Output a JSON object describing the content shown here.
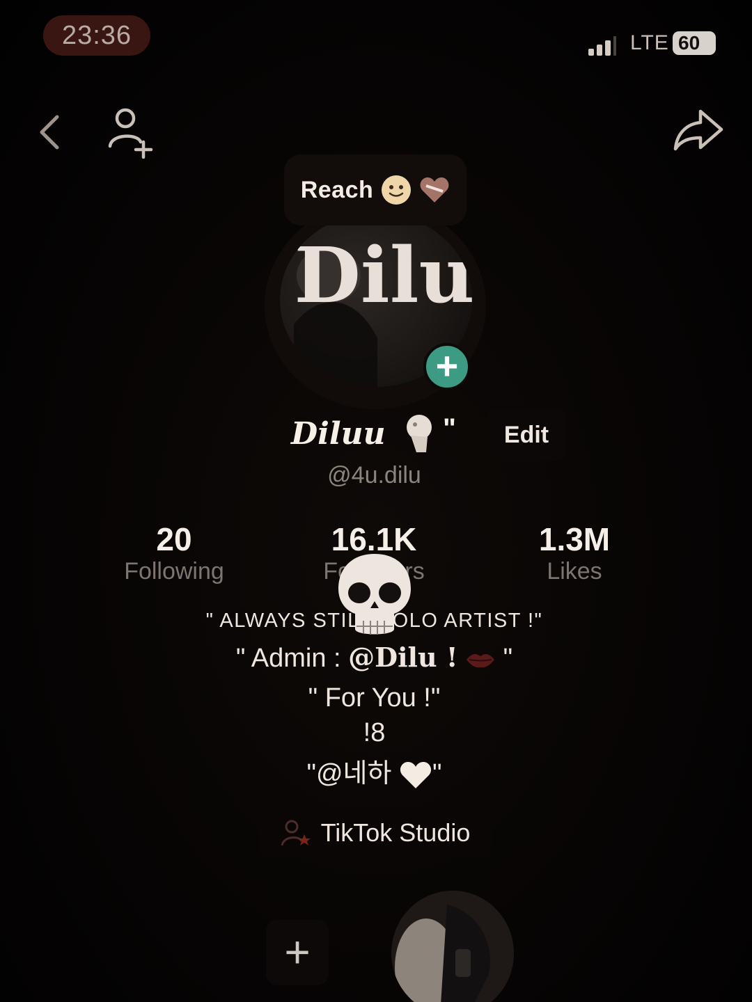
{
  "status_bar": {
    "time": "23:36",
    "network": "LTE",
    "battery": "60"
  },
  "nav": {
    "back_icon": "chevron-left-icon",
    "add_user_icon": "add-user-icon",
    "share_icon": "share-arrow-icon"
  },
  "note": {
    "text": "Reach"
  },
  "avatar": {
    "art_text": "Dilu"
  },
  "profile": {
    "display_name": "Diluu",
    "name_suffix": "\"",
    "edit_label": "Edit",
    "username": "@4u.dilu"
  },
  "stats": {
    "following": {
      "value": "20",
      "label": "Following"
    },
    "followers": {
      "value": "16.1K",
      "label": "Followers"
    },
    "likes": {
      "value": "1.3M",
      "label": "Likes"
    }
  },
  "bio": {
    "line1": "\" ALWAYS STILL SOLO ARTIST !\"",
    "line2_prefix": "\" Admin : ",
    "line2_handle": "@Dilu !",
    "line2_suffix": " \"",
    "line3": "\" For You !\"",
    "line4": "!8",
    "line5_prefix": "\"@네하 ",
    "line5_suffix": "\""
  },
  "studio": {
    "label": "TikTok Studio"
  },
  "bottom": {
    "create_label": "+"
  },
  "colors": {
    "accent_green": "#3d9a83",
    "time_pill": "#3a1612",
    "background": "#060404"
  }
}
